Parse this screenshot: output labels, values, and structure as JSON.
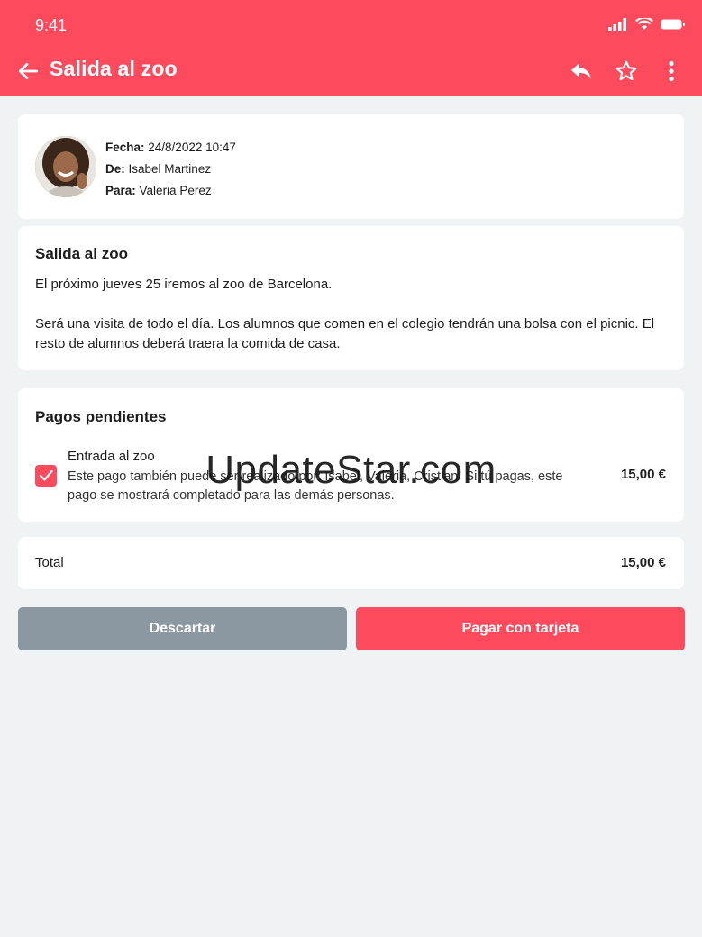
{
  "status_bar": {
    "time": "9:41"
  },
  "app_bar": {
    "title": "Salida al zoo",
    "icons": [
      "back-arrow-icon",
      "reply-icon",
      "star-outline-icon",
      "more-vertical-icon"
    ]
  },
  "message_header": {
    "fecha_label": "Fecha:",
    "fecha_value": "24/8/2022 10:47",
    "de_label": "De:",
    "de_value": "Isabel Martinez",
    "para_label": "Para:",
    "para_value": "Valeria Perez"
  },
  "message_body": {
    "subject": "Salida al zoo",
    "paragraph1": "El próximo jueves 25 iremos al zoo de Barcelona.",
    "paragraph2": "Será una visita de todo el día. Los alumnos que comen en el colegio tendrán una bolsa con el picnic. El resto de alumnos deberá traera la comida de casa."
  },
  "payments": {
    "title": "Pagos pendientes",
    "items": [
      {
        "name": "Entrada al zoo",
        "description": "Este pago también puede ser realizado por: Isabel, Valeria, Cristian. Si tú pagas, este pago se mostrará completado para las demás personas.",
        "price": "15,00 €",
        "checked": true
      }
    ]
  },
  "total": {
    "label": "Total",
    "value": "15,00 €"
  },
  "actions": {
    "discard_label": "Descartar",
    "pay_label": "Pagar con tarjeta"
  },
  "watermark": "UpdateStar.com",
  "colors": {
    "accent": "#fd4a5c",
    "discard": "#8b97a1",
    "background": "#f0f3f4"
  }
}
